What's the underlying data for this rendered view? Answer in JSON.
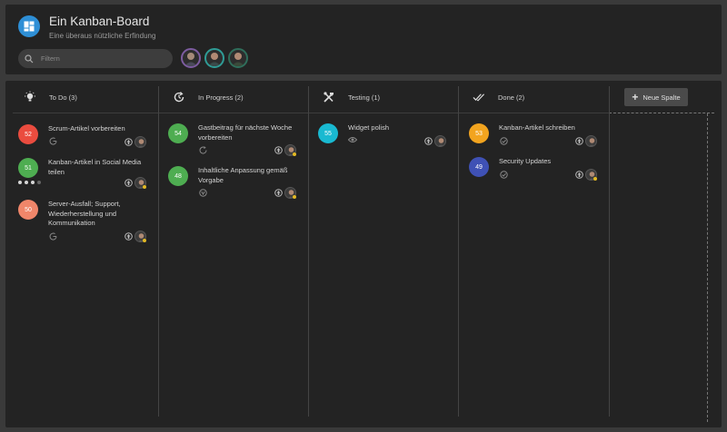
{
  "header": {
    "title": "Ein Kanban-Board",
    "subtitle": "Eine überaus nützliche Erfindung",
    "search_placeholder": "Filtern",
    "members": [
      "member-1",
      "member-2",
      "member-3"
    ]
  },
  "new_column_label": "Neue Spalte",
  "columns": [
    {
      "name": "To Do (3)",
      "icon": "lightbulb-icon",
      "cards": [
        {
          "id": "52",
          "title": "Scrum-Artikel vorbereiten",
          "color": "#ea4c3f"
        },
        {
          "id": "51",
          "title": "Kanban-Artikel in Social Media teilen",
          "color": "#4ead51"
        },
        {
          "id": "50",
          "title": "Server-Ausfall; Support, Wiederherstellung und Kommunikation",
          "color": "#f0866a"
        }
      ]
    },
    {
      "name": "In Progress (2)",
      "icon": "progress-icon",
      "cards": [
        {
          "id": "54",
          "title": "Gastbeitrag für nächste Woche vorbereiten",
          "color": "#4ead51"
        },
        {
          "id": "48",
          "title": "Inhaltliche Anpassung gemäß Vorgabe",
          "color": "#4ead51"
        }
      ]
    },
    {
      "name": "Testing (1)",
      "icon": "tools-icon",
      "cards": [
        {
          "id": "55",
          "title": "Widget polish",
          "color": "#19b9d1"
        }
      ]
    },
    {
      "name": "Done (2)",
      "icon": "double-check-icon",
      "cards": [
        {
          "id": "53",
          "title": "Kanban-Artikel schreiben",
          "color": "#f2a41f"
        },
        {
          "id": "49",
          "title": "Security Updates",
          "color": "#3f51b5"
        }
      ]
    }
  ]
}
